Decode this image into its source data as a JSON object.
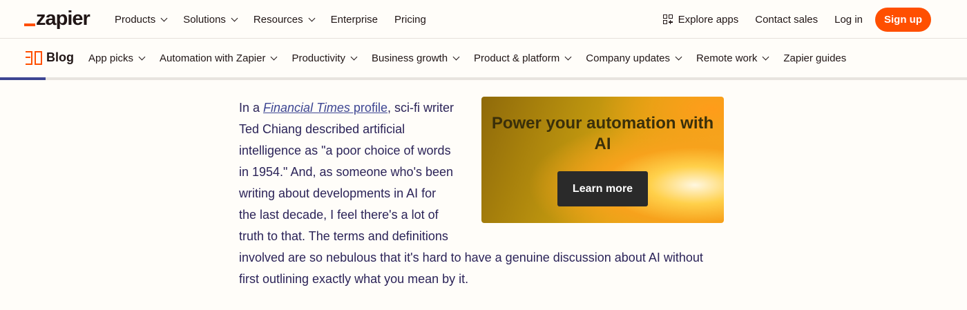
{
  "brand": {
    "name": "zapier"
  },
  "mainnav": {
    "items": [
      "Products",
      "Solutions",
      "Resources",
      "Enterprise",
      "Pricing"
    ]
  },
  "rightnav": {
    "explore": "Explore apps",
    "contact": "Contact sales",
    "login": "Log in",
    "signup": "Sign up"
  },
  "blognav": {
    "label": "Blog",
    "items": [
      "App picks",
      "Automation with Zapier",
      "Productivity",
      "Business growth",
      "Product & platform",
      "Company updates",
      "Remote work",
      "Zapier guides"
    ]
  },
  "reading_progress": 0.047,
  "article": {
    "p1_lead": "In a ",
    "p1_link_italic": "Financial Times",
    "p1_link_rest": " profile",
    "p1_rest": ", sci-fi writer Ted Chiang described artificial intelligence as \"a poor choice of words in 1954.\" And, as someone who's been writing about developments in AI for the last decade, I feel there's a lot of truth to that. The terms and definitions involved are so nebulous that it's hard to have a genuine discussion about AI without first outlining exactly what you mean by it."
  },
  "ad": {
    "title": "Power your automation with AI",
    "button": "Learn more"
  },
  "colors": {
    "accent": "#ff4f00",
    "link": "#3d4592",
    "text": "#2b2358"
  }
}
